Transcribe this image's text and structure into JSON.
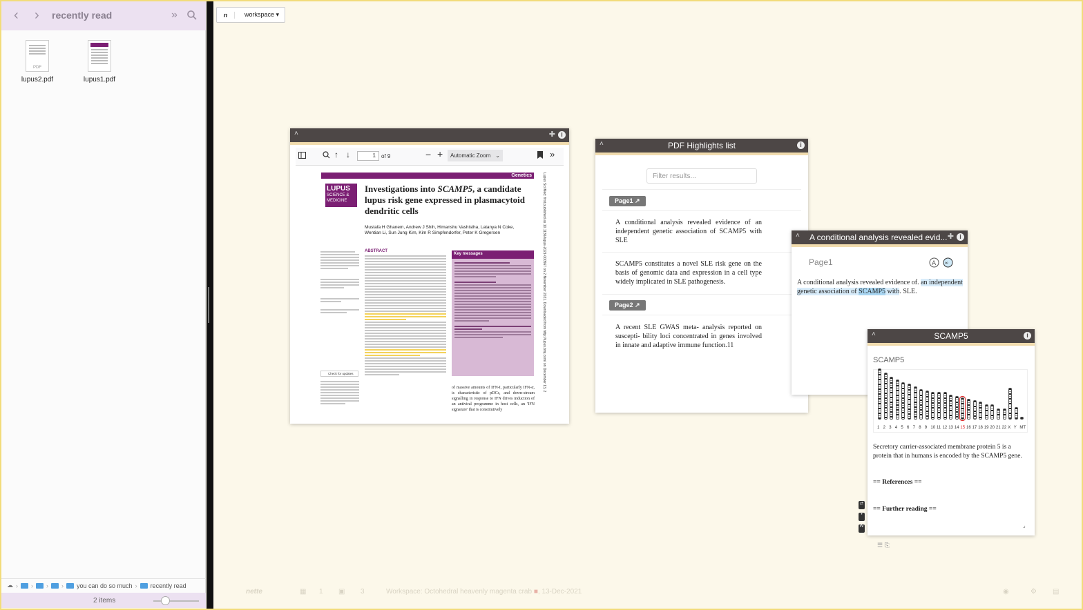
{
  "finder": {
    "title": "recently read",
    "files": [
      {
        "name": "lupus2.pdf"
      },
      {
        "name": "lupus1.pdf"
      }
    ],
    "path": [
      "you can do so much",
      "recently read"
    ],
    "path_ellipsis": "you can do so much",
    "status": "2 items",
    "thumb_label": "PDF"
  },
  "toolbar": {
    "logo": "n",
    "workspace_label": "workspace",
    "workspace_caret": "▾"
  },
  "pdf_viewer": {
    "page_input": "1",
    "page_total": "of 9",
    "zoom": "Automatic Zoom",
    "section": "Genetics",
    "journal_logo": [
      "LUPUS",
      "SCIENCE &",
      "MEDICINE"
    ],
    "title_pre": "Investigations into ",
    "title_gene": "SCAMP5",
    "title_post": ", a candidate lupus risk gene expressed in plasmacytoid dendritic cells",
    "authors": "Mustafa H Ghanem, Andrew J Shih, Himanshu Vashistha, Latanya N Coke, Wentian Li, Sun Jung Kim, Kim R Simpfendorfer, Peter K Gregersen",
    "abstract_label": "ABSTRACT",
    "key_messages": "Key messages",
    "check_updates": "Check for updates",
    "bottom_text": "of massive amounts of IFN-I, particularly IFN-α, is characteristic of pDCs, and down-stream signalling in response to IFN drives induction of an antiviral programme in host cells, an 'IFN signature' that is constitutively",
    "side_text": "Lupus Sci Med: first published as 10.1136/lupus-2021-000567 on 2 November 2021. Downloaded from http://lupus.bmj.com/ on December 13, 2"
  },
  "highlights": {
    "title": "PDF Highlights list",
    "filter_placeholder": "Filter results...",
    "groups": [
      {
        "page": "Page1 ↗",
        "items": [
          "A conditional analysis revealed evidence of an independent genetic association of SCAMP5 with SLE",
          "SCAMP5 constitutes a novel SLE risk gene on the basis of genomic data and expression in a cell type widely implicated in SLE pathogenesis."
        ]
      },
      {
        "page": "Page2 ↗",
        "items": [
          "A recent SLE GWAS meta- analysis reported on suscepti- bility loci concentrated in genes involved in innate and adaptive immune function.11"
        ]
      }
    ]
  },
  "conditional": {
    "title": "A conditional analysis revealed evid...",
    "page": "Page1",
    "text_pre": "A conditional analysis revealed evidence of. ",
    "text_hl1": "an independent genetic association of ",
    "text_gene": "SCAMP5",
    "text_hl2": " with",
    "text_post": ". SLE."
  },
  "scamp5": {
    "title": "SCAMP5",
    "subtitle": "SCAMP5",
    "description": "Secretory carrier-associated membrane protein 5 is a protein that in humans is encoded by the SCAMP5 gene.",
    "references": "== References ==",
    "further_reading": "== Further reading ==",
    "chromosomes": [
      "1",
      "2",
      "3",
      "4",
      "5",
      "6",
      "7",
      "8",
      "9",
      "10",
      "11",
      "12",
      "13",
      "14",
      "15",
      "16",
      "17",
      "18",
      "19",
      "20",
      "21",
      "22",
      "X",
      "Y",
      "MT"
    ],
    "highlighted_chromosome": "15"
  },
  "footer": {
    "logo": "nette",
    "count1": "1",
    "count2": "3",
    "workspace_text": "Workspace: Octohedral heavenly magenta crab",
    "date": "13-Dec-2021"
  },
  "colors": {
    "accent_purple": "#7b1f73",
    "panel_header": "#4d4746",
    "highlight_blue": "#d8ecfa",
    "highlight_yellow": "#f3d25a",
    "finder_bar": "#ece1f1",
    "background": "#fcf8ea"
  }
}
